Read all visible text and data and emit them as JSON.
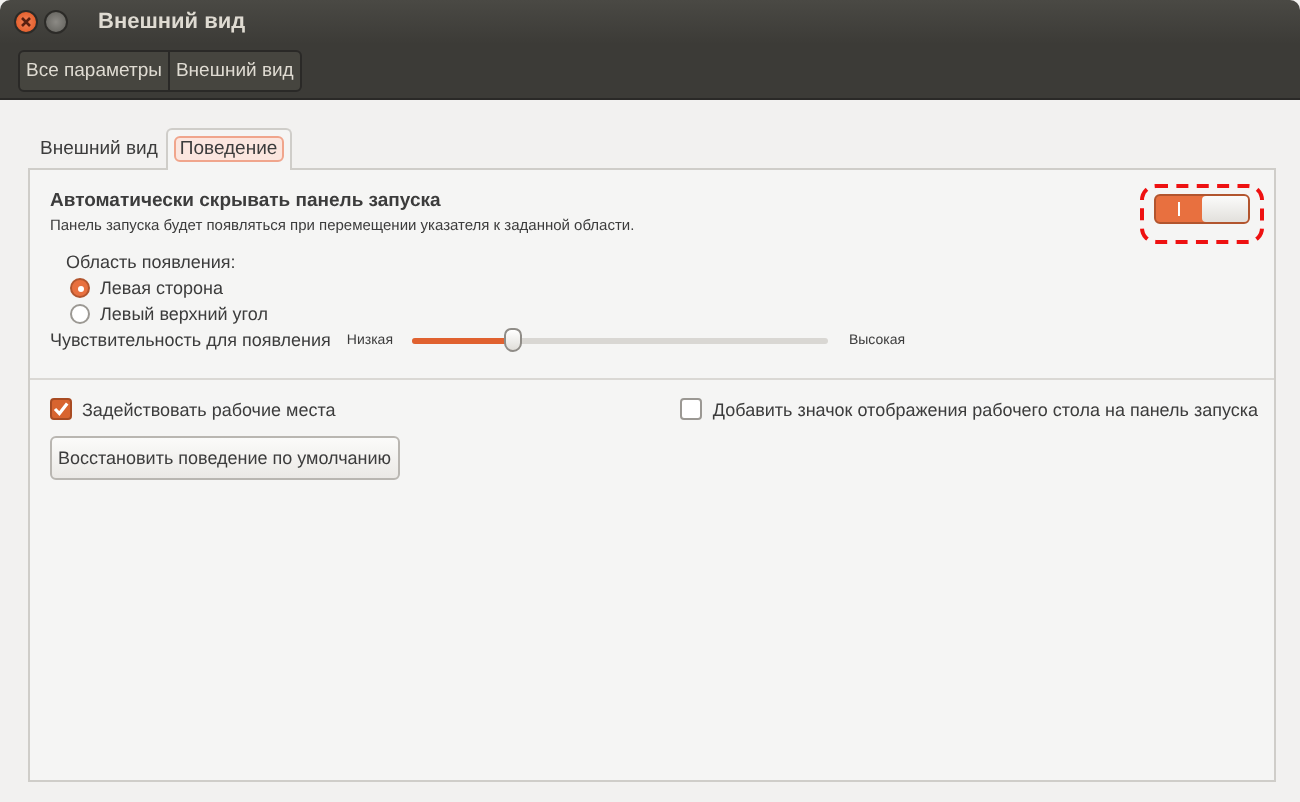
{
  "window": {
    "title": "Внешний вид"
  },
  "breadcrumbs": [
    {
      "label": "Все параметры"
    },
    {
      "label": "Внешний вид"
    }
  ],
  "tabs": [
    {
      "label": "Внешний вид",
      "selected": false
    },
    {
      "label": "Поведение",
      "selected": true
    }
  ],
  "autohide": {
    "title": "Автоматически скрывать панель запуска",
    "description": "Панель запуска будет появляться при перемещении указателя к заданной области.",
    "on": true,
    "highlighted": true
  },
  "reveal_area": {
    "label": "Область появления:",
    "options": [
      {
        "label": "Левая сторона",
        "selected": true
      },
      {
        "label": "Левый верхний угол",
        "selected": false
      }
    ]
  },
  "sensitivity": {
    "label": "Чувствительность для появления",
    "min_label": "Низкая",
    "max_label": "Высокая",
    "level": 0.24
  },
  "checkboxes": [
    {
      "label": "Задействовать рабочие места",
      "checked": true
    },
    {
      "label": "Добавить значок отображения рабочего стола на панель запуска",
      "checked": false
    }
  ],
  "buttons": [
    {
      "label": "Восстановить поведение по умолчанию"
    }
  ]
}
